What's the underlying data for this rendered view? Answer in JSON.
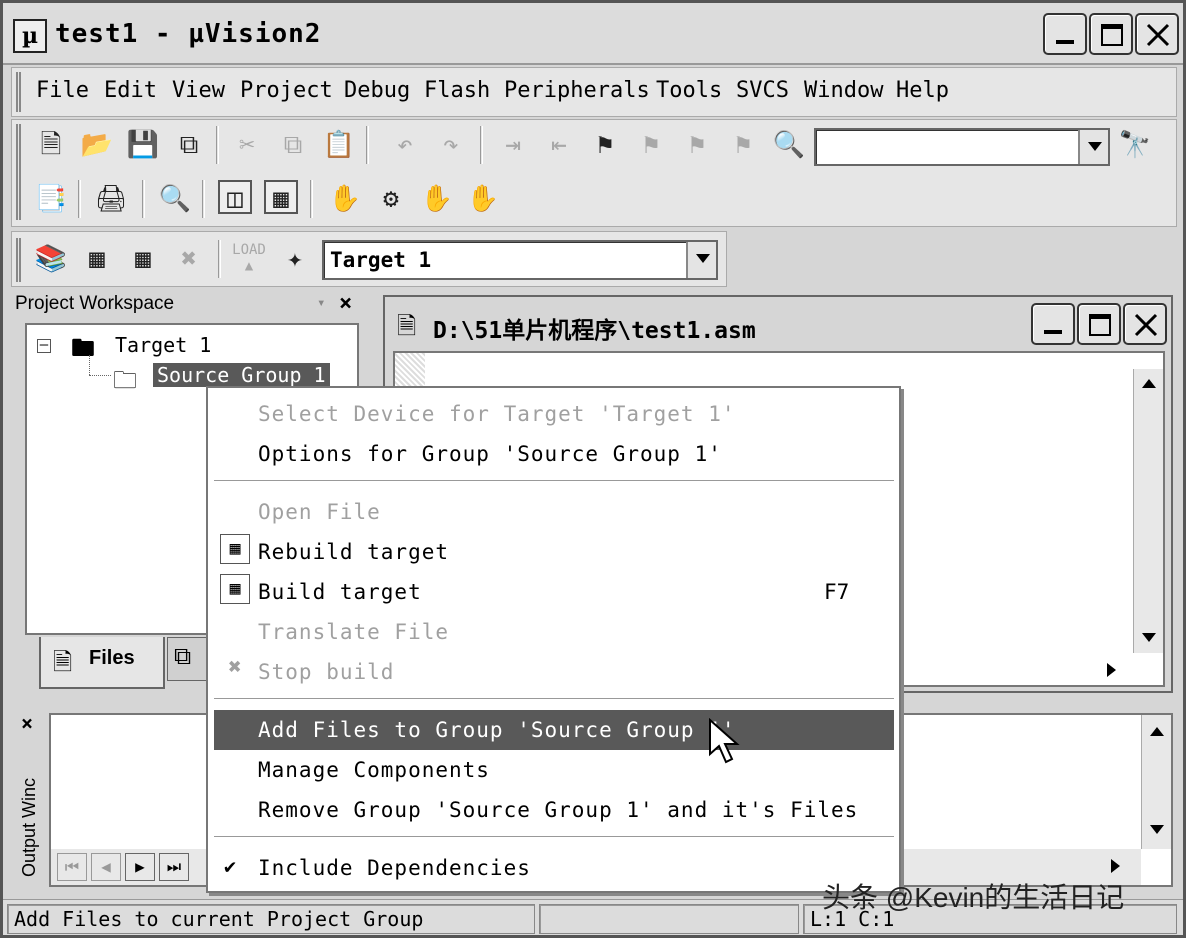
{
  "window": {
    "title": "test1  - µVision2",
    "app_icon": "uv-icon"
  },
  "menubar": {
    "items": [
      "File",
      "Edit",
      "View",
      "Project",
      "Debug",
      "Flash",
      "Peripherals",
      "Tools",
      "SVCS",
      "Window",
      "Help"
    ]
  },
  "toolbar": {
    "target_combo": "Target 1",
    "find_combo": ""
  },
  "workspace": {
    "title": "Project Workspace",
    "tree": {
      "root": "Target 1",
      "group": "Source Group 1"
    },
    "tab_files": "Files"
  },
  "editor": {
    "title": "D:\\51单片机程序\\test1.asm"
  },
  "output": {
    "title": "Output Winc"
  },
  "context_menu": {
    "items": [
      {
        "label": "Select Device for Target 'Target 1'",
        "enabled": false
      },
      {
        "label": "Options for Group 'Source Group 1'",
        "enabled": true
      },
      {
        "label": "Open File",
        "enabled": false
      },
      {
        "label": "Rebuild target",
        "enabled": true,
        "icon": "rebuild-icon"
      },
      {
        "label": "Build target",
        "enabled": true,
        "shortcut": "F7",
        "icon": "build-icon"
      },
      {
        "label": "Translate File",
        "enabled": false
      },
      {
        "label": "Stop build",
        "enabled": false,
        "icon": "stop-build-icon"
      },
      {
        "label": "Add Files to Group 'Source Group 1'",
        "enabled": true,
        "highlighted": true
      },
      {
        "label": "Manage Components",
        "enabled": true
      },
      {
        "label": "Remove Group 'Source Group 1'  and it's Files",
        "enabled": true
      },
      {
        "label": "Include Dependencies",
        "enabled": true,
        "checked": true
      }
    ]
  },
  "statusbar": {
    "message": "Add Files to current Project Group",
    "position": "L:1 C:1"
  },
  "watermark": "头条 @Kevin的生活日记",
  "colors": {
    "menu_highlight": "#595959",
    "window_bg": "#d6d6d6",
    "disabled_text": "#a0a0a0"
  }
}
